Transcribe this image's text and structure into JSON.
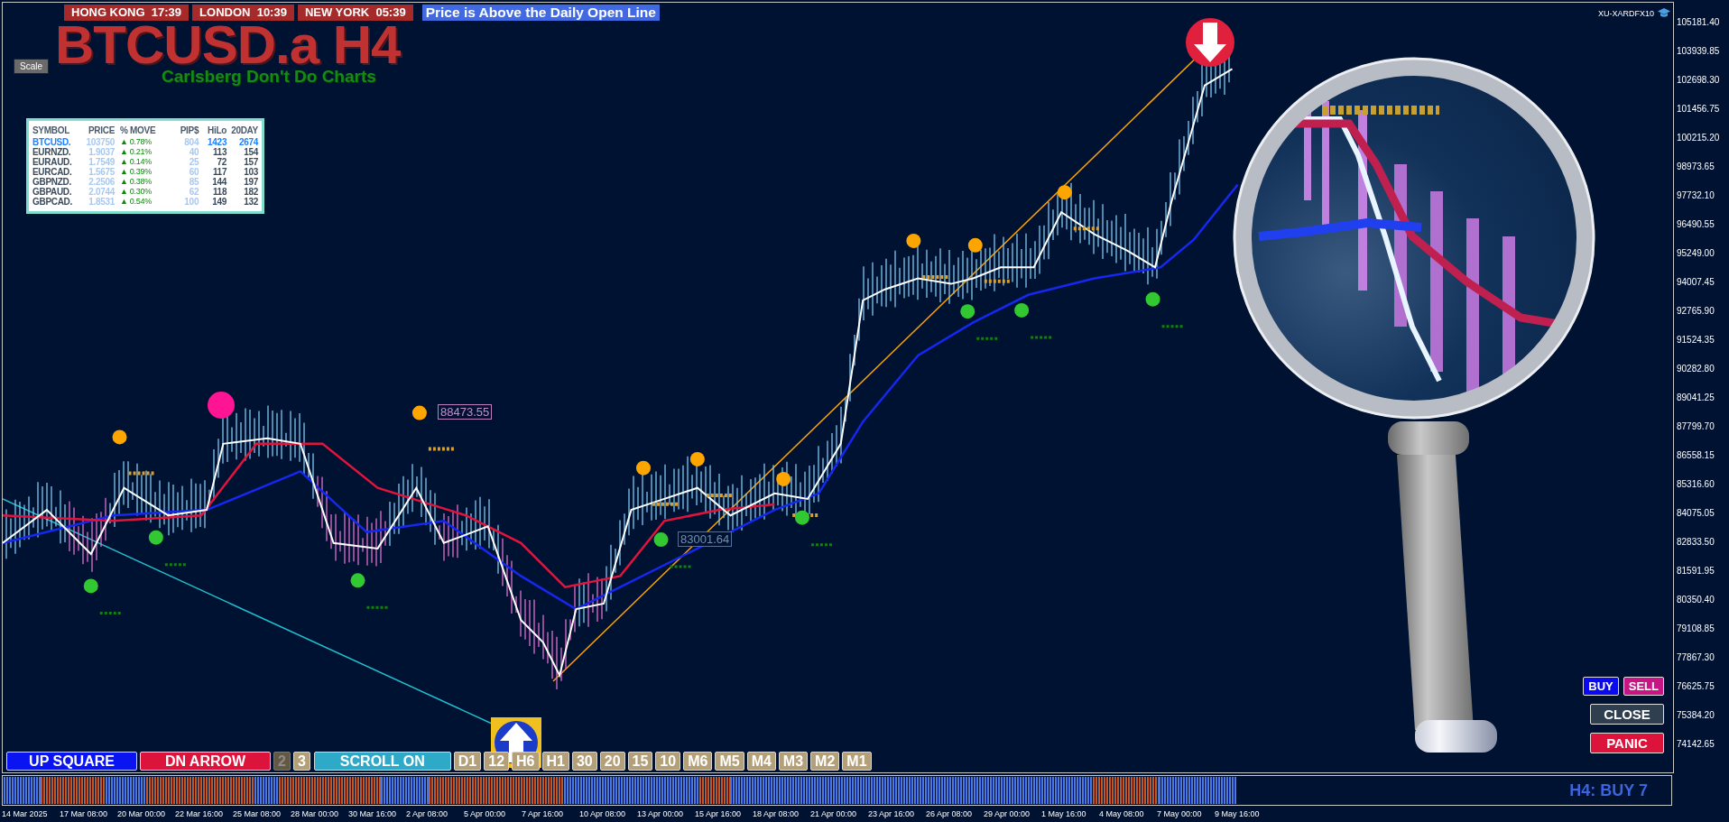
{
  "session_clocks": [
    {
      "city": "HONG KONG",
      "time": "17:39"
    },
    {
      "city": "LONDON",
      "time": "10:39"
    },
    {
      "city": "NEW YORK",
      "time": "05:39"
    }
  ],
  "status_banner": "Price is Above the Daily Open Line",
  "chart_title": "BTCUSD.a H4",
  "chart_subtitle": "Carlsberg Don't Do Charts",
  "scale_button": "Scale",
  "account_label": "XU-XARDFX10",
  "market_table": {
    "columns": [
      "SYMBOL",
      "PRICE",
      "% MOVE",
      "PIP$",
      "HiLo",
      "20DAY"
    ],
    "rows": [
      {
        "symbol": "BTCUSD.",
        "price": "103750",
        "move": "▲ 0.78%",
        "pips": "804",
        "hilo": "1423",
        "day20": "2674",
        "highlighted": true
      },
      {
        "symbol": "EURNZD.",
        "price": "1.9037",
        "move": "▲ 0.21%",
        "pips": "40",
        "hilo": "113",
        "day20": "154",
        "highlighted": false
      },
      {
        "symbol": "EURAUD.",
        "price": "1.7549",
        "move": "▲ 0.14%",
        "pips": "25",
        "hilo": "72",
        "day20": "157",
        "highlighted": false
      },
      {
        "symbol": "EURCAD.",
        "price": "1.5675",
        "move": "▲ 0.39%",
        "pips": "60",
        "hilo": "117",
        "day20": "103",
        "highlighted": false
      },
      {
        "symbol": "GBPNZD.",
        "price": "2.2506",
        "move": "▲ 0.38%",
        "pips": "85",
        "hilo": "144",
        "day20": "197",
        "highlighted": false
      },
      {
        "symbol": "GBPAUD.",
        "price": "2.0744",
        "move": "▲ 0.30%",
        "pips": "62",
        "hilo": "118",
        "day20": "182",
        "highlighted": false
      },
      {
        "symbol": "GBPCAD.",
        "price": "1.8531",
        "move": "▲ 0.54%",
        "pips": "100",
        "hilo": "149",
        "day20": "132",
        "highlighted": false
      }
    ]
  },
  "price_labels": [
    "88473.55",
    "83001.64"
  ],
  "trade_buttons": [
    {
      "label": "BUY",
      "kind": "buy"
    },
    {
      "label": "SELL",
      "kind": "sell"
    },
    {
      "label": "CLOSE",
      "kind": "close"
    },
    {
      "label": "PANIC",
      "kind": "panic"
    }
  ],
  "mode_buttons": [
    {
      "label": "UP SQUARE",
      "kind": "up",
      "selected": false
    },
    {
      "label": "DN ARROW",
      "kind": "down",
      "selected": false
    },
    {
      "label": "2",
      "kind": "step",
      "selected": true
    },
    {
      "label": "3",
      "kind": "step",
      "selected": false
    },
    {
      "label": "SCROLL ON",
      "kind": "scroll",
      "selected": false
    }
  ],
  "timeframe_buttons": [
    "D1",
    "12",
    "H6",
    "H1",
    "30",
    "20",
    "15",
    "10",
    "M6",
    "M5",
    "M4",
    "M3",
    "M2",
    "M1"
  ],
  "signal_status": "H4: BUY 7",
  "price_axis": [
    "105181.40",
    "103939.85",
    "102698.30",
    "101456.75",
    "100215.20",
    "98973.65",
    "97732.10",
    "96490.55",
    "95249.00",
    "94007.45",
    "92765.90",
    "91524.35",
    "90282.80",
    "89041.25",
    "87799.70",
    "86558.15",
    "85316.60",
    "84075.05",
    "82833.50",
    "81591.95",
    "80350.40",
    "79108.85",
    "77867.30",
    "76625.75",
    "75384.20",
    "74142.65"
  ],
  "time_axis": [
    "14 Mar 2025",
    "17 Mar 08:00",
    "20 Mar 00:00",
    "22 Mar 16:00",
    "25 Mar 08:00",
    "28 Mar 00:00",
    "30 Mar 16:00",
    "2 Apr 08:00",
    "5 Apr 00:00",
    "7 Apr 16:00",
    "10 Apr 08:00",
    "13 Apr 00:00",
    "15 Apr 16:00",
    "18 Apr 08:00",
    "21 Apr 00:00",
    "23 Apr 16:00",
    "26 Apr 08:00",
    "29 Apr 00:00",
    "1 May 16:00",
    "4 May 08:00",
    "7 May 00:00",
    "9 May 16:00"
  ]
}
